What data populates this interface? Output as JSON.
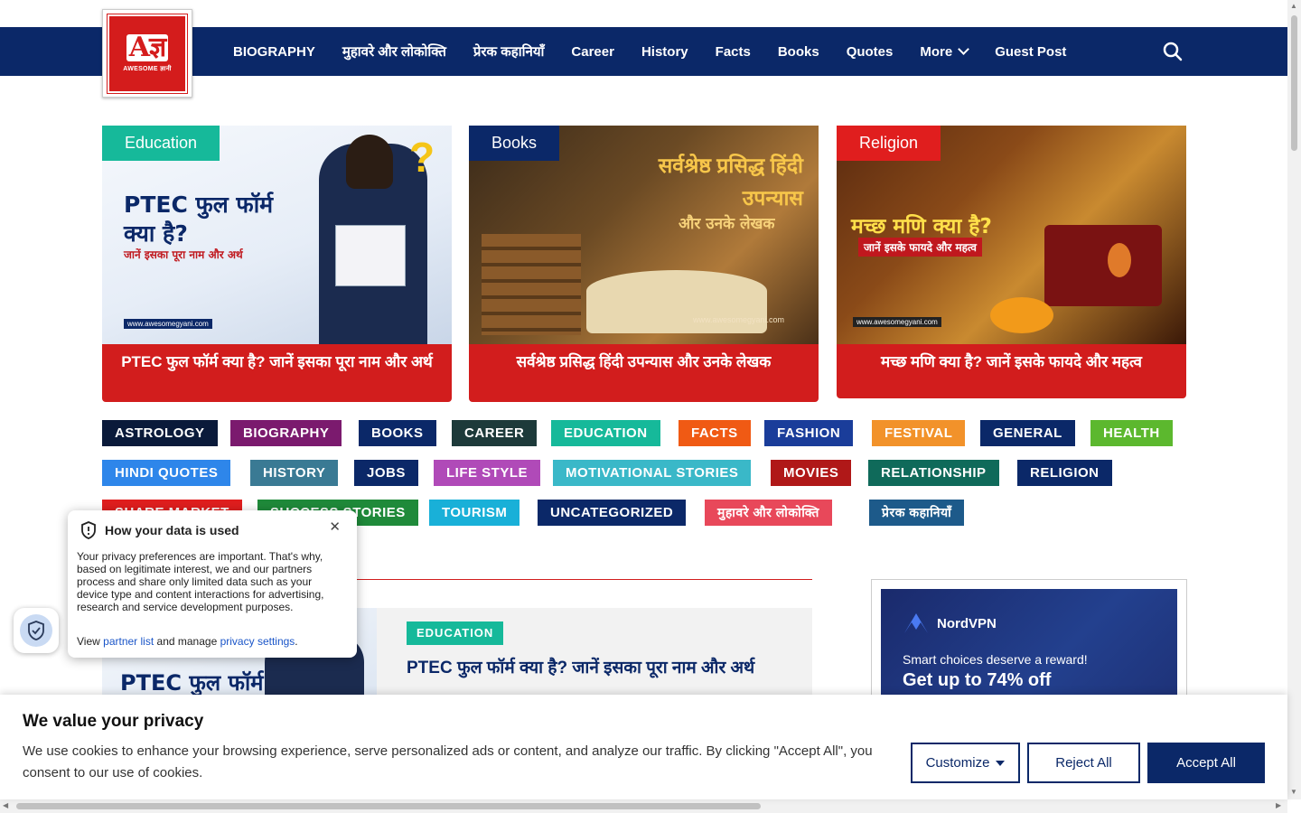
{
  "logo": {
    "mark": "Aज्ञ",
    "text": "AWESOME ज्ञानी"
  },
  "nav": {
    "items": [
      "BIOGRAPHY",
      "मुहावरे और लोकोक्ति",
      "प्रेरक कहानियाँ",
      "Career",
      "History",
      "Facts",
      "Books",
      "Quotes",
      "More",
      "Guest Post"
    ]
  },
  "cards": [
    {
      "tag": "Education",
      "tag_color": "#16b99a",
      "headline": "PTEC फुल फॉर्म क्या है?",
      "sub": "जानें इसका पूरा नाम और अर्थ",
      "caption": "PTEC फुल फॉर्म क्या है? जानें इसका पूरा नाम और अर्थ"
    },
    {
      "tag": "Books",
      "tag_color": "#0b2868",
      "headline": "सर्वश्रेष्ठ प्रसिद्ध हिंदी उपन्यास",
      "sub": "और उनके लेखक",
      "caption": "सर्वश्रेष्ठ प्रसिद्ध हिंदी उपन्यास और उनके लेखक"
    },
    {
      "tag": "Religion",
      "tag_color": "#e01e1e",
      "headline": "मच्छ मणि क्या है?",
      "sub": "जानें इसके फायदे और महत्व",
      "caption": "मच्छ मणि क्या है? जानें इसके फायदे और महत्व"
    }
  ],
  "image_watermark": "www.awesomegyani.com",
  "categories": [
    {
      "label": "ASTROLOGY",
      "color": "#0a1a3a"
    },
    {
      "label": "BIOGRAPHY",
      "color": "#7b1a6e"
    },
    {
      "label": "BOOKS",
      "color": "#0b2868"
    },
    {
      "label": "CAREER",
      "color": "#1d3a3a"
    },
    {
      "label": "EDUCATION",
      "color": "#16b99a"
    },
    {
      "label": "FACTS",
      "color": "#f05a14"
    },
    {
      "label": "FASHION",
      "color": "#1a3d9a"
    },
    {
      "label": "FESTIVAL",
      "color": "#f2922a"
    },
    {
      "label": "GENERAL",
      "color": "#0b2868"
    },
    {
      "label": "HEALTH",
      "color": "#5cb82e"
    },
    {
      "label": "HINDI QUOTES",
      "color": "#2e86ea"
    },
    {
      "label": "HISTORY",
      "color": "#3a7a94"
    },
    {
      "label": "JOBS",
      "color": "#0b2868"
    },
    {
      "label": "LIFE STYLE",
      "color": "#b04ab8"
    },
    {
      "label": "MOTIVATIONAL STORIES",
      "color": "#3ab8c8"
    },
    {
      "label": "MOVIES",
      "color": "#b01818"
    },
    {
      "label": "RELATIONSHIP",
      "color": "#0f6a5a"
    },
    {
      "label": "RELIGION",
      "color": "#0b2868"
    },
    {
      "label": "SHARE MARKET",
      "color": "#e01e1e"
    },
    {
      "label": "SUCCESS STORIES",
      "color": "#1f8a3a"
    },
    {
      "label": "TOURISM",
      "color": "#19b0d8"
    },
    {
      "label": "UNCATEGORIZED",
      "color": "#0b2868"
    },
    {
      "label": "मुहावरे और लोकोक्ति",
      "color": "#e8485a"
    },
    {
      "label": "प्रेरक कहानियाँ",
      "color": "#1d5a8a"
    }
  ],
  "list_item": {
    "tag": "EDUCATION",
    "title": "PTEC फुल फॉर्म क्या है? जानें इसका पूरा नाम और अर्थ",
    "thumb_text": "PTEC फुल फॉर्म"
  },
  "ad": {
    "brand": "NordVPN",
    "line1": "Smart choices deserve a reward!",
    "line2": "Get up to 74% off"
  },
  "privacy_popup": {
    "title": "How your data is used",
    "body": "Your privacy preferences are important. That's why, based on legitimate interest, we and our partners process and share only limited data such as your device type and content interactions for advertising, research and service development purposes.",
    "view": "View",
    "partner_link": "partner list",
    "and_manage": "and manage",
    "settings_link": "privacy settings",
    "period": "."
  },
  "cookie": {
    "title": "We value your privacy",
    "text": "We use cookies to enhance your browsing experience, serve personalized ads or content, and analyze our traffic. By clicking \"Accept All\", you consent to our use of cookies.",
    "customize": "Customize",
    "reject": "Reject All",
    "accept": "Accept All"
  }
}
